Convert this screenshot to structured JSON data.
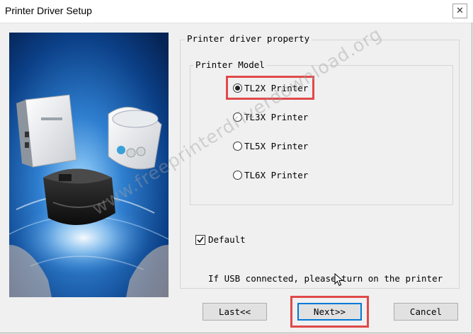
{
  "window": {
    "title": "Printer Driver Setup",
    "close_glyph": "✕",
    "icon": "close-icon"
  },
  "property_group": {
    "legend": "Printer driver property"
  },
  "model_group": {
    "legend": "Printer Model",
    "options": [
      {
        "label": "TL2X Printer",
        "selected": true
      },
      {
        "label": "TL3X Printer",
        "selected": false
      },
      {
        "label": "TL5X Printer",
        "selected": false
      },
      {
        "label": "TL6X Printer",
        "selected": false
      }
    ]
  },
  "default_checkbox": {
    "label": "Default",
    "checked": true
  },
  "usb_note": "If USB connected, please turn on the printer",
  "buttons": {
    "last": "Last<<",
    "next": "Next>>",
    "cancel": "Cancel"
  },
  "watermark": "www.freeprinterdriverdownload.org",
  "colors": {
    "highlight": "#e0494a",
    "focus_border": "#0078d7",
    "window_bg": "#f0f0f0"
  }
}
